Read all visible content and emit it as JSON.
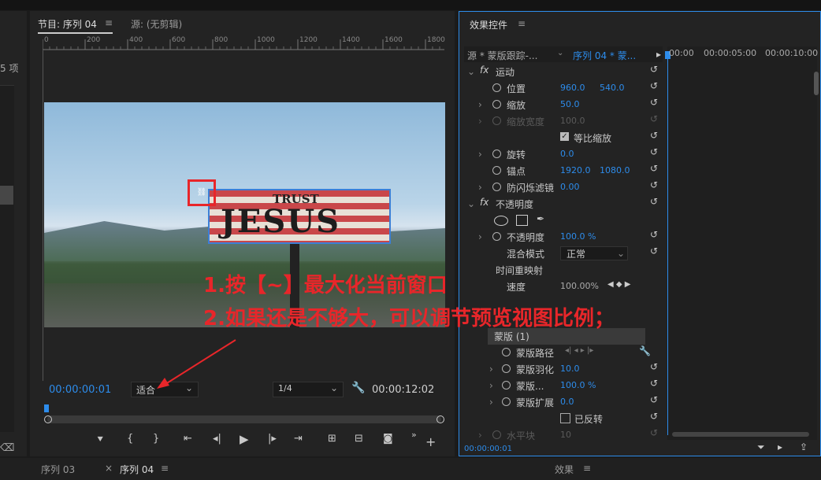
{
  "left_panel": {
    "partial_label": "5 项"
  },
  "program_monitor": {
    "tab_program": "节目: 序列 04",
    "tab_source": "源: (无剪辑)",
    "ruler_ticks": [
      "0",
      "200",
      "400",
      "600",
      "800",
      "1000",
      "1200",
      "1400",
      "1600",
      "1800"
    ],
    "timecode_current": "00:00:00:01",
    "zoom_value": "适合",
    "resolution_value": "1/4",
    "timecode_duration": "00:00:12:02",
    "billboard_line1": "TRUST",
    "billboard_line2": "JESUS"
  },
  "effect_controls": {
    "title": "效果控件",
    "source_label": "源 * 蒙版跟踪-...",
    "sequence_label": "序列 04 * 蒙...",
    "timeline_ticks": [
      "00:00",
      "00:00:05:00",
      "00:00:10:00"
    ],
    "footer_timecode": "00:00:00:01",
    "motion": "运动",
    "position": {
      "label": "位置",
      "x": "960.0",
      "y": "540.0"
    },
    "scale": {
      "label": "缩放",
      "value": "50.0"
    },
    "scale_width": {
      "label": "缩放宽度",
      "value": "100.0"
    },
    "uniform_scale": "等比缩放",
    "rotation": {
      "label": "旋转",
      "value": "0.0"
    },
    "anchor": {
      "label": "锚点",
      "x": "1920.0",
      "y": "1080.0"
    },
    "antiflicker": {
      "label": "防闪烁滤镜",
      "value": "0.00"
    },
    "opacity_section": "不透明度",
    "opacity": {
      "label": "不透明度",
      "value": "100.0 %"
    },
    "blend_mode": {
      "label": "混合模式",
      "value": "正常"
    },
    "time_remap": "时间重映射",
    "speed": {
      "label": "速度",
      "value": "100.00%"
    },
    "mask": "蒙版 (1)",
    "mask_path": "蒙版路径",
    "mask_feather": {
      "label": "蒙版羽化",
      "value": "10.0"
    },
    "mask_opacity": {
      "label": "蒙版...",
      "value": "100.0 %"
    },
    "mask_expansion": {
      "label": "蒙版扩展",
      "value": "0.0"
    },
    "inverted": "已反转",
    "horizontal": {
      "label": "水平块",
      "value": "10"
    }
  },
  "bottom_tabs": {
    "seq03": "序列 03",
    "seq04": "序列 04",
    "effects": "效果"
  },
  "annotations": {
    "line1": "1.按【~】最大化当前窗口",
    "line2": "2.如果还是不够大，可以调节预览视图比例；"
  },
  "colors": {
    "accent": "#2d8ceb",
    "annotation": "#e8262a",
    "panel_border": "#2d8ceb"
  }
}
